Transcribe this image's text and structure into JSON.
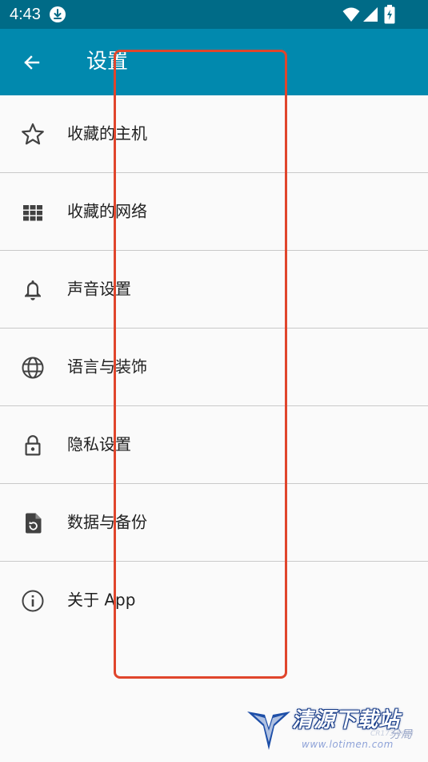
{
  "status_bar": {
    "time": "4:43",
    "icons": [
      "download-icon",
      "wifi-icon",
      "signal-icon",
      "battery-charging-icon"
    ]
  },
  "app_bar": {
    "title": "设置",
    "back_icon": "arrow-back-icon"
  },
  "settings": {
    "items": [
      {
        "label": "收藏的主机",
        "icon": "star-outline-icon"
      },
      {
        "label": "收藏的网络",
        "icon": "grid-icon"
      },
      {
        "label": "声音设置",
        "icon": "bell-icon"
      },
      {
        "label": "语言与装饰",
        "icon": "globe-icon"
      },
      {
        "label": "隐私设置",
        "icon": "lock-icon"
      },
      {
        "label": "数据与备份",
        "icon": "file-restore-icon"
      },
      {
        "label": "关于 App",
        "icon": "info-icon"
      }
    ]
  },
  "colors": {
    "status_bar": "#006b87",
    "app_bar": "#0189ae",
    "background": "#fafafa",
    "divider": "#c9c9c9",
    "highlight": "#e0452c",
    "icon": "#424242",
    "text": "#212121"
  },
  "watermark": {
    "name": "清源下载站",
    "sub": "分局",
    "domain": "www.lotimen.com",
    "domain_small": "CR173.COM"
  }
}
